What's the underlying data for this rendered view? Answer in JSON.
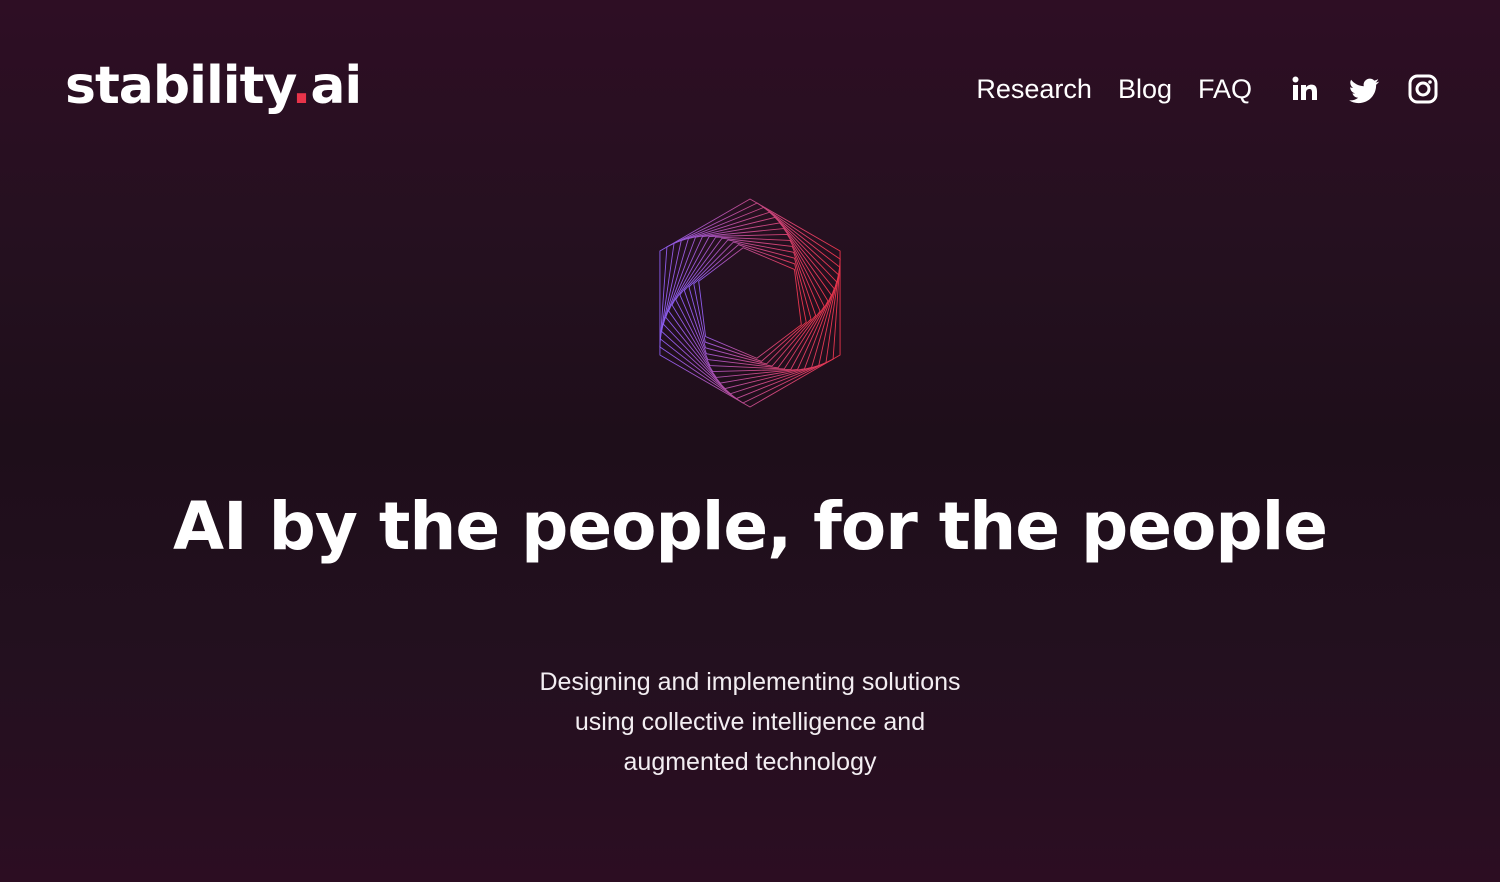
{
  "brand": {
    "name": "stability",
    "dot": ".",
    "suffix": "ai",
    "accent_color": "#e8344a"
  },
  "nav": {
    "items": [
      {
        "label": "Research"
      },
      {
        "label": "Blog"
      },
      {
        "label": "FAQ"
      }
    ]
  },
  "social": {
    "icons": [
      "linkedin-icon",
      "twitter-icon",
      "instagram-icon"
    ]
  },
  "hero": {
    "graphic": "hexagon-logo",
    "gradient_colors": [
      "#8a5cf0",
      "#e8344a"
    ],
    "headline": "AI by the people, for the people",
    "subtitle_lines": [
      "Designing and implementing solutions",
      "using collective intelligence and",
      "augmented technology"
    ]
  },
  "colors": {
    "background_top": "#2e0e24",
    "background_mid": "#1e0e1a",
    "text": "#ffffff"
  }
}
